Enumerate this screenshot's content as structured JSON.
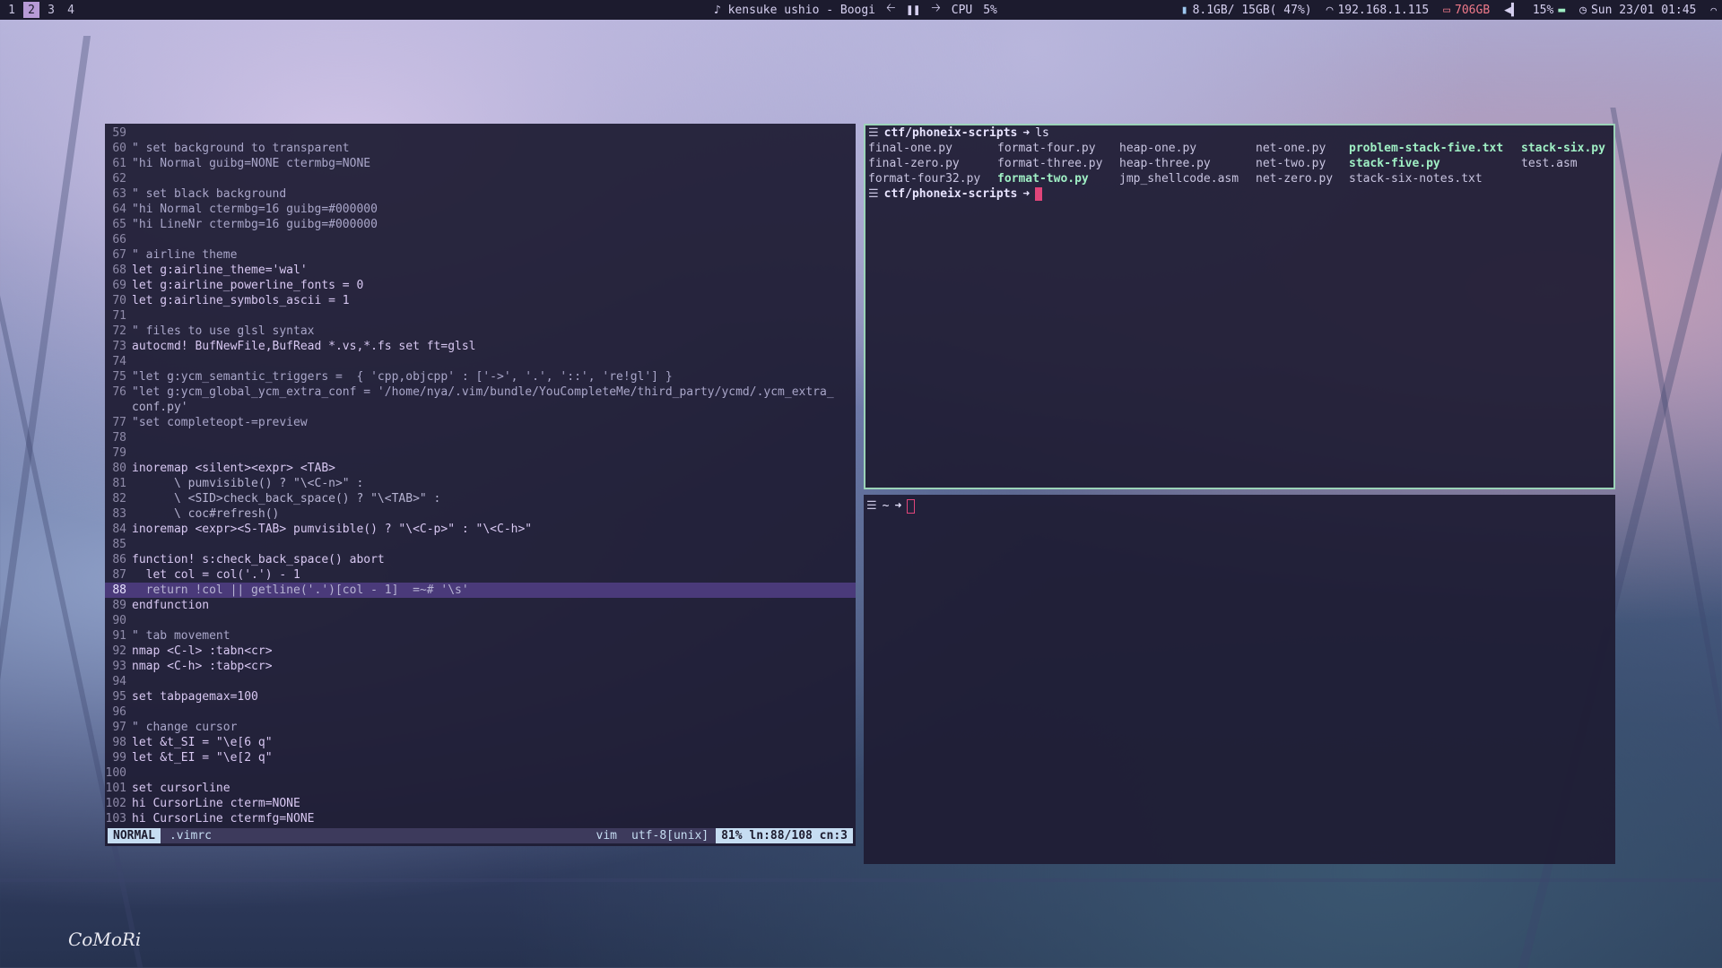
{
  "topbar": {
    "workspaces": [
      "1",
      "2",
      "3",
      "4"
    ],
    "active_workspace": "2",
    "now_playing": "♪ kensuke ushio - Boogi",
    "cpu_label": "CPU",
    "cpu_value": "5%",
    "memory": "8.1GB/ 15GB( 47%)",
    "ip": "192.168.1.115",
    "disk": "706GB",
    "volume": "15%",
    "datetime": "Sun 23/01 01:45",
    "colors": {
      "bg": "#1c1b2e",
      "active": "#b79ad6"
    }
  },
  "vim": {
    "lines": [
      {
        "n": "59",
        "t": ""
      },
      {
        "n": "60",
        "t": "\" set background to transparent"
      },
      {
        "n": "61",
        "t": "\"hi Normal guibg=NONE ctermbg=NONE"
      },
      {
        "n": "62",
        "t": ""
      },
      {
        "n": "63",
        "t": "\" set black background"
      },
      {
        "n": "64",
        "t": "\"hi Normal ctermbg=16 guibg=#000000"
      },
      {
        "n": "65",
        "t": "\"hi LineNr ctermbg=16 guibg=#000000"
      },
      {
        "n": "66",
        "t": ""
      },
      {
        "n": "67",
        "t": "\" airline theme"
      },
      {
        "n": "68",
        "t": "let g:airline_theme='wal'"
      },
      {
        "n": "69",
        "t": "let g:airline_powerline_fonts = 0"
      },
      {
        "n": "70",
        "t": "let g:airline_symbols_ascii = 1"
      },
      {
        "n": "71",
        "t": ""
      },
      {
        "n": "72",
        "t": "\" files to use glsl syntax"
      },
      {
        "n": "73",
        "t": "autocmd! BufNewFile,BufRead *.vs,*.fs set ft=glsl"
      },
      {
        "n": "74",
        "t": ""
      },
      {
        "n": "75",
        "t": "\"let g:ycm_semantic_triggers =  { 'cpp,objcpp' : ['->', '.', '::', 're!gl'] }"
      },
      {
        "n": "76",
        "t": "\"let g:ycm_global_ycm_extra_conf = '/home/nya/.vim/bundle/YouCompleteMe/third_party/ycmd/.ycm_extra_"
      },
      {
        "n": "",
        "t": "conf.py'"
      },
      {
        "n": "77",
        "t": "\"set completeopt-=preview"
      },
      {
        "n": "78",
        "t": ""
      },
      {
        "n": "79",
        "t": ""
      },
      {
        "n": "80",
        "t": "inoremap <silent><expr> <TAB>"
      },
      {
        "n": "81",
        "t": "      \\ pumvisible() ? \"\\<C-n>\" :"
      },
      {
        "n": "82",
        "t": "      \\ <SID>check_back_space() ? \"\\<TAB>\" :"
      },
      {
        "n": "83",
        "t": "      \\ coc#refresh()"
      },
      {
        "n": "84",
        "t": "inoremap <expr><S-TAB> pumvisible() ? \"\\<C-p>\" : \"\\<C-h>\""
      },
      {
        "n": "85",
        "t": ""
      },
      {
        "n": "86",
        "t": "function! s:check_back_space() abort"
      },
      {
        "n": "87",
        "t": "  let col = col('.') - 1"
      },
      {
        "n": "88",
        "t": "  return !col || getline('.')[col - 1]  =~# '\\s'"
      },
      {
        "n": "89",
        "t": "endfunction"
      },
      {
        "n": "90",
        "t": ""
      },
      {
        "n": "91",
        "t": "\" tab movement"
      },
      {
        "n": "92",
        "t": "nmap <C-l> :tabn<cr>"
      },
      {
        "n": "93",
        "t": "nmap <C-h> :tabp<cr>"
      },
      {
        "n": "94",
        "t": ""
      },
      {
        "n": "95",
        "t": "set tabpagemax=100"
      },
      {
        "n": "96",
        "t": ""
      },
      {
        "n": "97",
        "t": "\" change cursor"
      },
      {
        "n": "98",
        "t": "let &t_SI = \"\\e[6 q\""
      },
      {
        "n": "99",
        "t": "let &t_EI = \"\\e[2 q\""
      },
      {
        "n": "100",
        "t": ""
      },
      {
        "n": "101",
        "t": "set cursorline"
      },
      {
        "n": "102",
        "t": "hi CursorLine cterm=NONE"
      },
      {
        "n": "103",
        "t": "hi CursorLine ctermfg=NONE"
      }
    ],
    "current_line": "88",
    "status": {
      "mode": "NORMAL",
      "file": ".vimrc",
      "filetype": "vim",
      "encoding": "utf-8[unix]",
      "position": "81% ln:88/108 cn:3"
    }
  },
  "terminal_top": {
    "prompt_path": "ctf/phoneix-scripts",
    "command": "ls",
    "files": [
      {
        "name": "final-one.py",
        "exec": false
      },
      {
        "name": "format-four.py",
        "exec": false
      },
      {
        "name": "heap-one.py",
        "exec": false
      },
      {
        "name": "net-one.py",
        "exec": false
      },
      {
        "name": "problem-stack-five.txt",
        "exec": true
      },
      {
        "name": "stack-six.py",
        "exec": true
      },
      {
        "name": "final-zero.py",
        "exec": false
      },
      {
        "name": "format-three.py",
        "exec": false
      },
      {
        "name": "heap-three.py",
        "exec": false
      },
      {
        "name": "net-two.py",
        "exec": false
      },
      {
        "name": "stack-five.py",
        "exec": true
      },
      {
        "name": "test.asm",
        "exec": false
      },
      {
        "name": "format-four32.py",
        "exec": false
      },
      {
        "name": "format-two.py",
        "exec": true
      },
      {
        "name": "jmp_shellcode.asm",
        "exec": false
      },
      {
        "name": "net-zero.py",
        "exec": false
      },
      {
        "name": "stack-six-notes.txt",
        "exec": false
      },
      {
        "name": "",
        "exec": false
      }
    ],
    "prompt_path_2": "ctf/phoneix-scripts"
  },
  "terminal_bottom": {
    "prompt_path": "~"
  },
  "wallpaper_signature": "CoMoRi"
}
